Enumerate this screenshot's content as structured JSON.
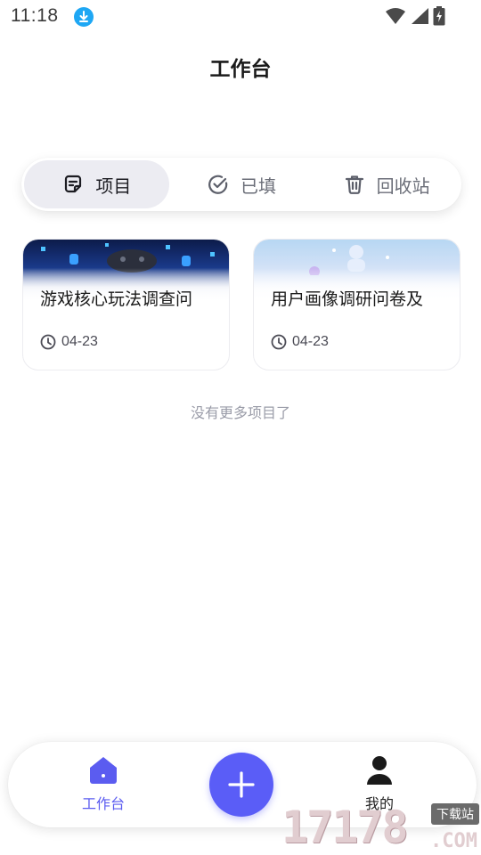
{
  "status_bar": {
    "time": "11:18",
    "icons": [
      "download-icon",
      "wifi-icon",
      "signal-icon",
      "battery-charging-icon"
    ]
  },
  "header": {
    "title": "工作台"
  },
  "tabs": [
    {
      "label": "项目",
      "icon": "note-icon",
      "active": true
    },
    {
      "label": "已填",
      "icon": "check-circle-icon",
      "active": false
    },
    {
      "label": "回收站",
      "icon": "trash-icon",
      "active": false
    }
  ],
  "projects": [
    {
      "title": "游戏核心玩法调查问",
      "date": "04-23"
    },
    {
      "title": "用户画像调研问卷及",
      "date": "04-23"
    }
  ],
  "list_footer": "没有更多项目了",
  "bottom_nav": {
    "home_label": "工作台",
    "me_label": "我的",
    "accent": "#5a5df7"
  },
  "watermark": {
    "number": "17178",
    "tag": "下载站",
    "suffix": ".COM"
  }
}
